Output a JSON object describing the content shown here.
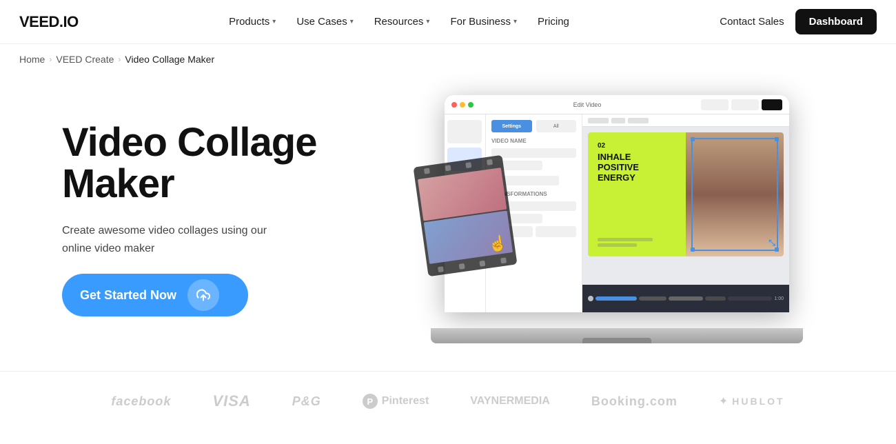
{
  "header": {
    "logo": "VEED.IO",
    "nav": [
      {
        "label": "Products",
        "has_dropdown": true
      },
      {
        "label": "Use Cases",
        "has_dropdown": true
      },
      {
        "label": "Resources",
        "has_dropdown": true
      },
      {
        "label": "For Business",
        "has_dropdown": true
      },
      {
        "label": "Pricing",
        "has_dropdown": false
      }
    ],
    "contact_sales": "Contact Sales",
    "dashboard": "Dashboard"
  },
  "breadcrumb": {
    "items": [
      "Home",
      "VEED Create",
      "Video Collage Maker"
    ]
  },
  "hero": {
    "title": "Video Collage Maker",
    "subtitle": "Create awesome video collages using our online video maker",
    "cta_label": "Get Started Now",
    "cta_icon": "↑"
  },
  "editor": {
    "title": "Edit Video",
    "tab_settings": "Settings",
    "tab_all": "All",
    "collage_number": "02",
    "collage_text_line1": "INHALE",
    "collage_text_line2": "POSITIVE",
    "collage_text_line3": "ENERGY"
  },
  "brands": [
    {
      "name": "facebook",
      "label": "facebook"
    },
    {
      "name": "visa",
      "label": "VISA"
    },
    {
      "name": "pg",
      "label": "P&G"
    },
    {
      "name": "pinterest",
      "label": "Pinterest"
    },
    {
      "name": "vayner-media",
      "label": "VAYNER",
      "suffix": "MEDIA"
    },
    {
      "name": "booking",
      "label": "Booking.com"
    },
    {
      "name": "hublot",
      "label": "HUBLOT"
    }
  ]
}
